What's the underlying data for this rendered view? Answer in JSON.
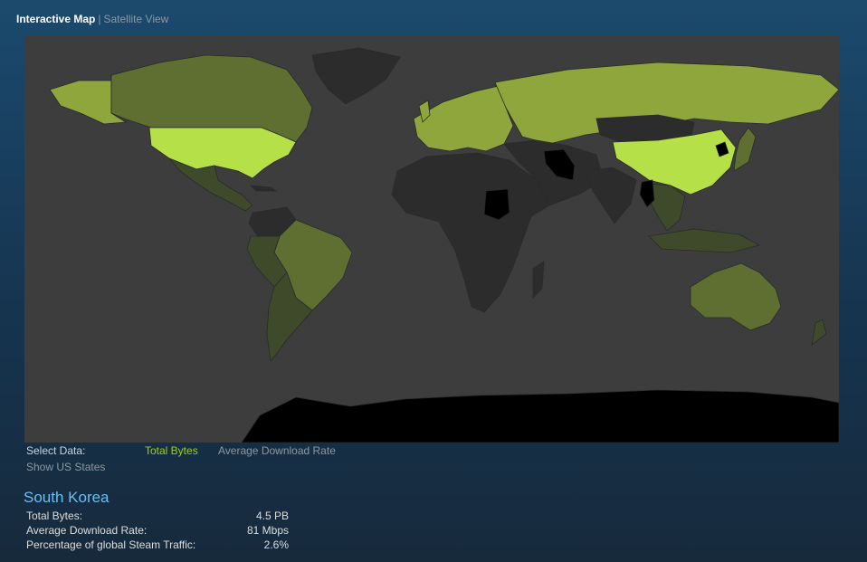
{
  "view_tabs": {
    "interactive": "Interactive Map",
    "separator": "|",
    "satellite": "Satellite View"
  },
  "colors": {
    "background": "#1b4a6e",
    "map_background": "#3d3d3d",
    "level_highest": "#b5e048",
    "level_high": "#8ea63b",
    "level_mid": "#5f6f32",
    "level_low": "#3e4a2a",
    "level_none": "#2c2c2c",
    "level_missing": "#000000",
    "accent": "#a4d007",
    "title": "#66c0f4"
  },
  "select_data": {
    "label": "Select Data:",
    "options": [
      {
        "label": "Total Bytes",
        "active": true
      },
      {
        "label": "Average Download Rate",
        "active": false
      }
    ],
    "show_us_states": "Show US States"
  },
  "selected_country": {
    "name": "South Korea",
    "stats": [
      {
        "label": "Total Bytes:",
        "value": "4.5 PB"
      },
      {
        "label": "Average Download Rate:",
        "value": "81 Mbps"
      },
      {
        "label": "Percentage of global Steam Traffic:",
        "value": "2.6%"
      }
    ]
  }
}
